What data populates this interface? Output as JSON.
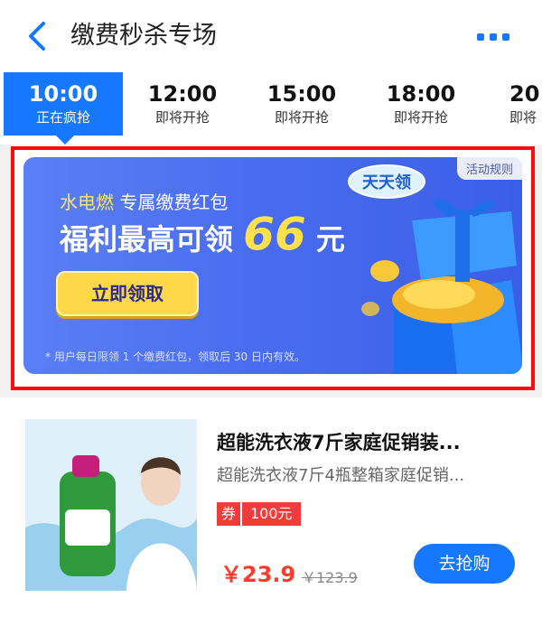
{
  "header": {
    "title": "缴费秒杀专场",
    "back_icon": "chevron-left-icon",
    "more_icon": "more-dots-icon",
    "accent": "#1677ff"
  },
  "tabs": [
    {
      "time": "10:00",
      "status": "正在疯抢",
      "active": true
    },
    {
      "time": "12:00",
      "status": "即将开抢"
    },
    {
      "time": "15:00",
      "status": "即将开抢"
    },
    {
      "time": "18:00",
      "status": "即将开抢"
    },
    {
      "time": "20",
      "status": "即将"
    }
  ],
  "banner": {
    "rules": "活动规则",
    "badge": "天天领",
    "subtitle_highlight": "水电燃",
    "subtitle_rest": "专属缴费红包",
    "headline_prefix": "福利最高可领",
    "headline_amount": "66",
    "headline_unit": "元",
    "cta": "立即领取",
    "note": "* 用户每日限领 1 个缴费红包，领取后 30 日内有效。",
    "highlight_border_color": "#ff0a0a"
  },
  "product": {
    "title": "超能洗衣液7斤家庭促销装...",
    "subtitle": "超能洗衣液7斤4瓶整箱家庭促销...",
    "coupon_tag": "券",
    "coupon_value": "100元",
    "price": "￥23.9",
    "original_price": "￥123.9",
    "buy": "去抢购"
  }
}
